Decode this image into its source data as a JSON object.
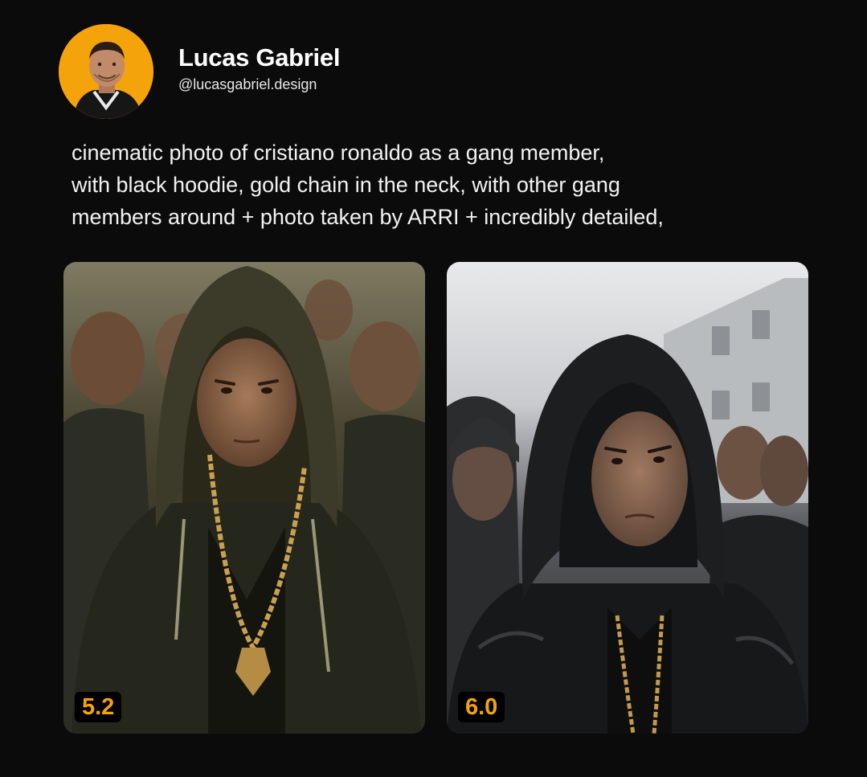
{
  "profile": {
    "name": "Lucas Gabriel",
    "handle": "@lucasgabriel.design",
    "avatar_bg": "#f5a30a"
  },
  "prompt": {
    "text": "cinematic photo of cristiano ronaldo as a gang member,\nwith black hoodie, gold chain in the neck, with other gang\nmembers around + photo taken by ARRI + incredibly detailed,"
  },
  "images": [
    {
      "badge": "5.2"
    },
    {
      "badge": "6.0"
    }
  ],
  "colors": {
    "background": "#0b0b0b",
    "accent": "#f5a30a",
    "badge_bg": "#000000"
  }
}
